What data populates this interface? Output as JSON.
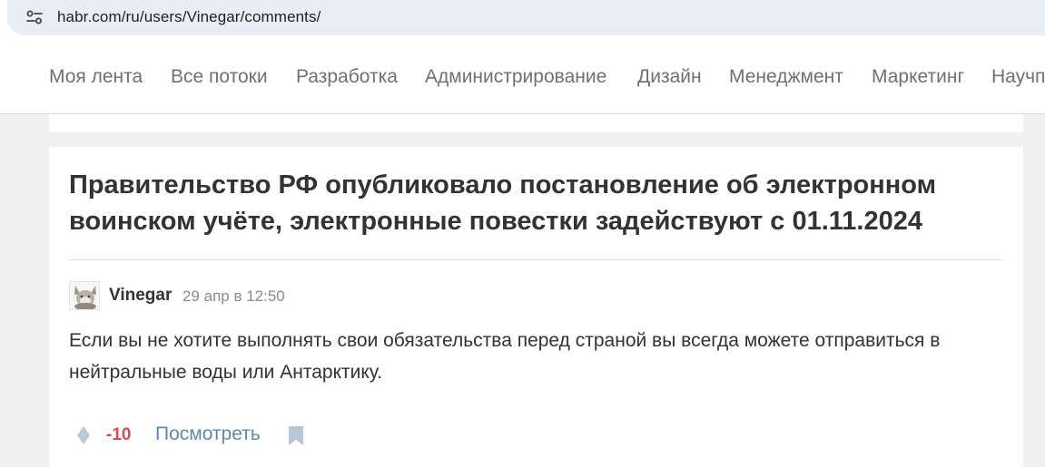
{
  "browser": {
    "url": "habr.com/ru/users/Vinegar/comments/",
    "site_info_icon": "site-settings-icon"
  },
  "nav": {
    "items": [
      {
        "label": "Моя лента"
      },
      {
        "label": "Все потоки"
      },
      {
        "label": "Разработка"
      },
      {
        "label": "Администрирование"
      },
      {
        "label": "Дизайн"
      },
      {
        "label": "Менеджмент"
      },
      {
        "label": "Маркетинг"
      },
      {
        "label": "Научпоп"
      }
    ]
  },
  "comment_card": {
    "post_title": "Правительство РФ опубликовало постановление об электронном воинском учёте, электронные повестки задействуют с 01.11.2024",
    "author": "Vinegar",
    "time": "29 апр в 12:50",
    "text": "Если вы не хотите выполнять свои обязательства перед страной вы всегда можете отправиться в нейтральные воды или Антарктику.",
    "score": "-10",
    "view_link": "Посмотреть",
    "icons": {
      "vote": "vote-icon",
      "bookmark": "bookmark-icon",
      "avatar": "cat-avatar"
    },
    "colors": {
      "score_negative": "#d04e4e",
      "link": "#5e8aa8"
    }
  }
}
